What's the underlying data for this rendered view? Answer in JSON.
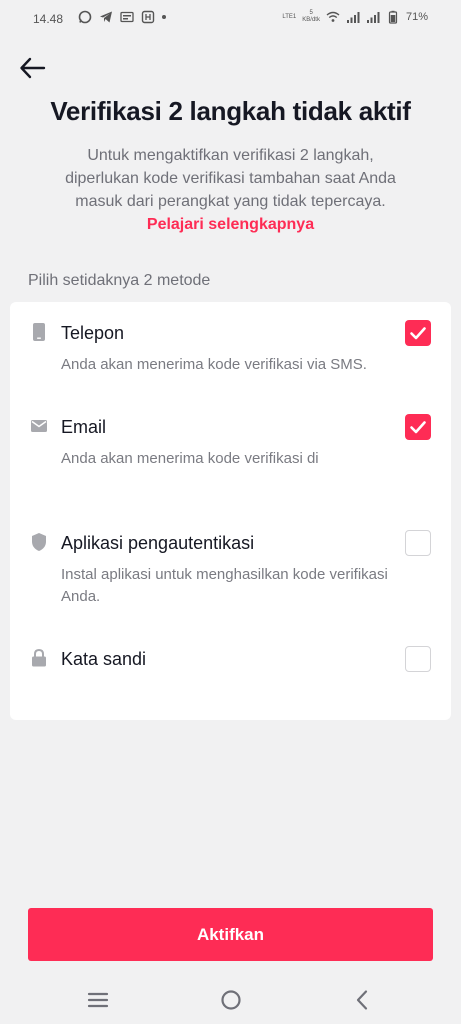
{
  "status_bar": {
    "time": "14.48",
    "net_top": "5",
    "net_bottom": "KB/dtk",
    "lte": "LTE1",
    "battery": "71%"
  },
  "header": {
    "title": "Verifikasi 2 langkah tidak aktif",
    "description": "Untuk mengaktifkan verifikasi 2 langkah, diperlukan kode verifikasi tambahan saat Anda masuk dari perangkat yang tidak tepercaya.",
    "learn_more": "Pelajari selengkapnya"
  },
  "section_label": "Pilih setidaknya 2 metode",
  "methods": [
    {
      "icon": "phone-icon",
      "name": "Telepon",
      "note": "Anda akan menerima kode verifikasi via SMS.",
      "checked": true
    },
    {
      "icon": "mail-icon",
      "name": "Email",
      "note": "Anda akan menerima kode verifikasi di",
      "checked": true
    },
    {
      "icon": "shield-icon",
      "name": "Aplikasi pengautentikasi",
      "note": "Instal aplikasi untuk menghasilkan kode verifikasi Anda.",
      "checked": false
    },
    {
      "icon": "lock-icon",
      "name": "Kata sandi",
      "note": "",
      "checked": false
    }
  ],
  "cta_label": "Aktifkan",
  "colors": {
    "accent": "#fe2c55",
    "background": "#f1f1f2",
    "card": "#ffffff"
  }
}
